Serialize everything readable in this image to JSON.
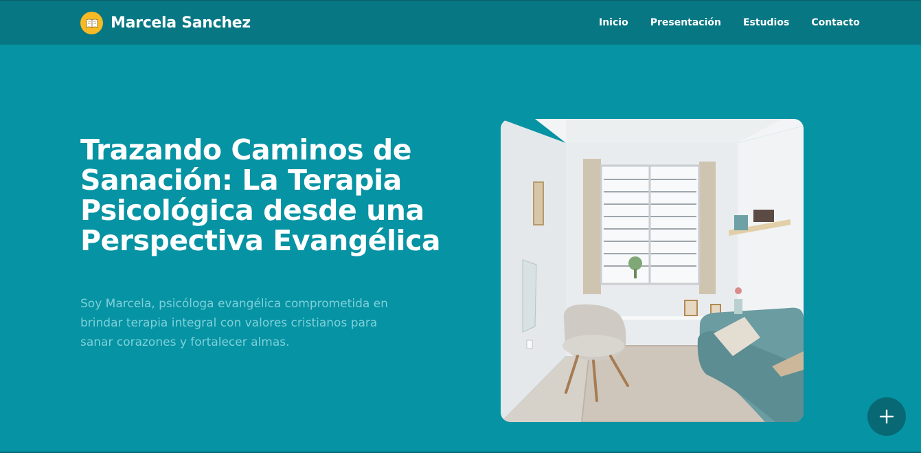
{
  "brand": {
    "name": "Marcela Sanchez",
    "logo_icon": "open-book-icon"
  },
  "nav": {
    "items": [
      {
        "label": "Inicio"
      },
      {
        "label": "Presentación"
      },
      {
        "label": "Estudios"
      },
      {
        "label": "Contacto"
      }
    ]
  },
  "hero": {
    "title": "Trazando Caminos de Sanación: La Terapia Psicológica desde una Perspectiva Evangélica",
    "text": "Soy Marcela, psicóloga evangélica comprometida en brindar terapia integral con valores cristianos para sanar corazones y fortalecer almas.",
    "image_alt": "therapy-room-photo"
  },
  "fab": {
    "icon": "plus-icon"
  },
  "colors": {
    "background": "#0693a3",
    "navbar": "#077784",
    "logo": "#f7b924",
    "text_muted": "#7fd0da",
    "fab": "#086874"
  }
}
